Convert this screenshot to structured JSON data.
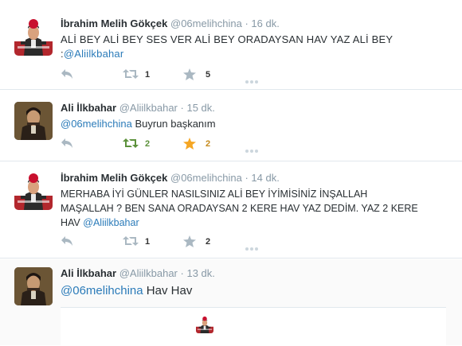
{
  "tweets": [
    {
      "name": "İbrahim Melih Gökçek",
      "handle": "@06melihchina",
      "sep": "·",
      "time": "16 dk.",
      "line1": "ALİ BEY ALİ BEY SES VER ALİ BEY ORADAYSAN HAV YAZ ALİ BEY",
      "line2": ":",
      "mention": "@Aliilkbahar",
      "retweets": "1",
      "favorites": "5"
    },
    {
      "name": "Ali İlkbahar",
      "handle": "@Aliilkbahar",
      "sep": "·",
      "time": "15 dk.",
      "mention": "@06melihchina",
      "text": "Buyrun başkanım",
      "retweets": "2",
      "favorites": "2"
    },
    {
      "name": "İbrahim Melih Gökçek",
      "handle": "@06melihchina",
      "sep": "·",
      "time": "14 dk.",
      "line1": "MERHABA İYİ GÜNLER NASILSINIZ ALİ BEY İYİMİSİNİZ İNŞALLAH",
      "line2": "MAŞALLAH ? BEN SANA ORADAYSAN 2 KERE HAV YAZ DEDİM. YAZ 2 KERE",
      "line3": "HAV",
      "mention": "@Aliilkbahar",
      "retweets": "1",
      "favorites": "2"
    },
    {
      "name": "Ali İlkbahar",
      "handle": "@Aliilkbahar",
      "sep": "·",
      "time": "13 dk.",
      "mention": "@06melihchina",
      "text": "Hav Hav"
    }
  ],
  "colors": {
    "link": "#2b7bb9",
    "retweet_active": "#5c913b",
    "favorite_active": "#f5a623",
    "icon_inactive": "#aab8c2"
  },
  "icons": {
    "reply": "reply-icon",
    "retweet": "retweet-icon",
    "favorite": "star-icon",
    "more": "more-dots-icon"
  }
}
